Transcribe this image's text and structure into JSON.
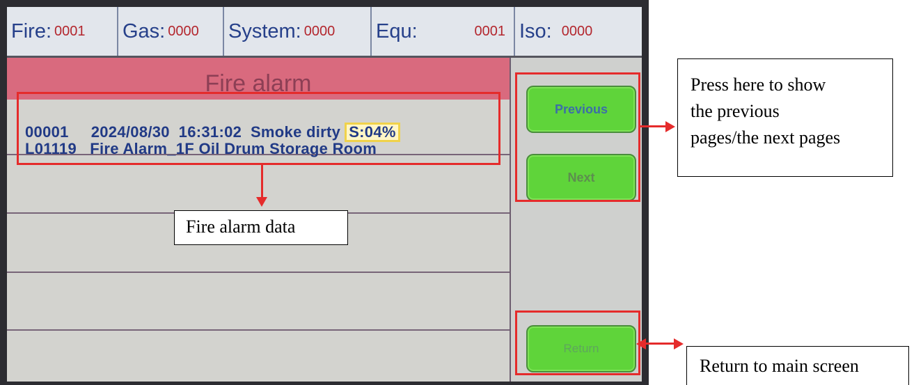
{
  "status": {
    "fire": {
      "label": "Fire:",
      "value": "0001"
    },
    "gas": {
      "label": "Gas:",
      "value": "0000"
    },
    "system": {
      "label": "System:",
      "value": "0000"
    },
    "equ": {
      "label": "Equ:",
      "value": "0001"
    },
    "iso": {
      "label": "Iso:",
      "value": "0000"
    }
  },
  "list": {
    "title": "Fire alarm",
    "record": {
      "line1": "00001     2024/08/30  16:31:02  Smoke dirty",
      "badge": "S:04%",
      "line2": "L01119   Fire Alarm_1F Oil Drum Storage Room"
    }
  },
  "buttons": {
    "previous": "Previous",
    "next": "Next",
    "return": "Return"
  },
  "annotations": {
    "fire_alarm_data": "Fire alarm data",
    "press_here": [
      "Press here to show",
      "the previous",
      "pages/the next pages"
    ],
    "return_main": "Return to main screen"
  },
  "colors": {
    "annotation_red": "#e52b2b",
    "button_green": "#5fd43a",
    "header_red": "#d96a7e"
  }
}
